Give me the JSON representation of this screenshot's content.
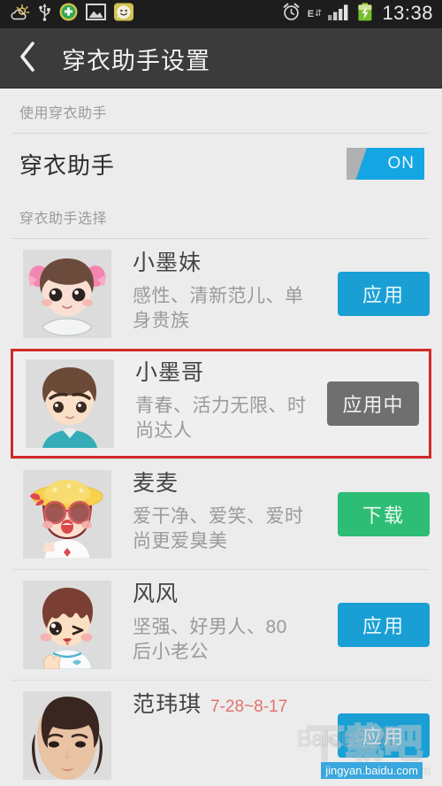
{
  "status_bar": {
    "icons": [
      "weather-icon",
      "usb-icon",
      "green-badge-icon",
      "gallery-icon",
      "smiley-icon"
    ],
    "right_icons": [
      "alarm-icon",
      "edge-network-icon",
      "signal-icon",
      "battery-charging-icon"
    ],
    "network_label": "E",
    "time": "13:38"
  },
  "header": {
    "back_icon": "back-chevron-icon",
    "title": "穿衣助手设置"
  },
  "sections": [
    {
      "label": "使用穿衣助手"
    },
    {
      "label": "穿衣助手选择"
    }
  ],
  "master_switch": {
    "label": "穿衣助手",
    "state_label": "ON",
    "on": true,
    "on_color": "#14a5e3",
    "off_color": "#aeb0b1"
  },
  "assistants": [
    {
      "name": "小墨妹",
      "desc": "感性、清新范儿、单身贵族",
      "avatar": "girl-twin-buns-avatar",
      "button": {
        "label": "应用",
        "style": "apply",
        "color": "#1a9fd4"
      },
      "selected": false
    },
    {
      "name": "小墨哥",
      "desc": "青春、活力无限、时尚达人",
      "avatar": "boy-brown-hair-avatar",
      "button": {
        "label": "应用中",
        "style": "applied",
        "color": "#6f6f6f"
      },
      "selected": true,
      "highlight_color": "#cf2a27"
    },
    {
      "name": "麦麦",
      "desc": "爱干净、爱笑、爱时尚更爱臭美",
      "avatar": "girl-sunhat-sunglasses-avatar",
      "button": {
        "label": "下载",
        "style": "download",
        "color": "#2ebd74"
      },
      "selected": false
    },
    {
      "name": "风风",
      "desc": "坚强、好男人、80后小老公",
      "avatar": "boy-winking-thumbsup-avatar",
      "button": {
        "label": "应用",
        "style": "apply",
        "color": "#1a9fd4"
      },
      "selected": false
    },
    {
      "name": "范玮琪",
      "date": "7-28~8-17",
      "desc": "",
      "avatar": "celebrity-photo-avatar",
      "button": {
        "label": "应用",
        "style": "apply",
        "color": "#1a9fd4"
      },
      "selected": false
    }
  ],
  "watermarks": {
    "site_text": "下载吧",
    "site_url": "www.xiazaiba.com",
    "baidu_text": "Baidu经验",
    "baidu_url": "jingyan.baidu.com"
  }
}
